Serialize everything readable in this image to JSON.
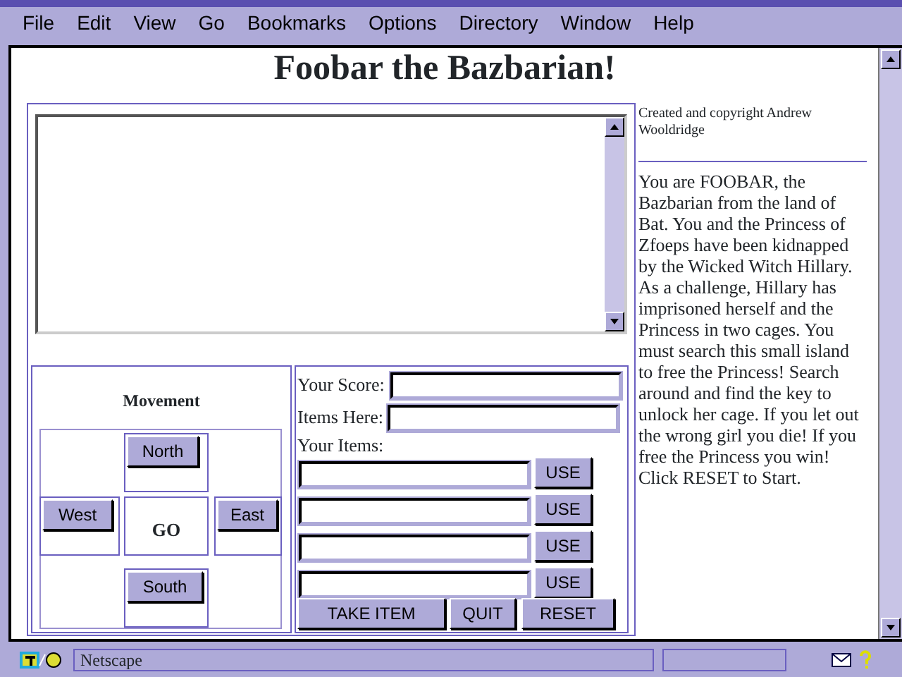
{
  "menu": [
    "File",
    "Edit",
    "View",
    "Go",
    "Bookmarks",
    "Options",
    "Directory",
    "Window",
    "Help"
  ],
  "heading": "Foobar the Bazbarian!",
  "movement": {
    "title": "Movement",
    "north": "North",
    "west": "West",
    "center": "GO",
    "east": "East",
    "south": "South"
  },
  "score": {
    "label": "Your Score:"
  },
  "items_here": {
    "label": "Items Here:"
  },
  "your_items": {
    "label": "Your Items:",
    "slots": [
      {
        "button": "USE"
      },
      {
        "button": "USE"
      },
      {
        "button": "USE"
      },
      {
        "button": "USE"
      }
    ]
  },
  "actions": [
    "TAKE ITEM",
    "QUIT",
    "RESET"
  ],
  "credit": "Created and copyright Andrew Wooldridge",
  "story": "You are FOOBAR, the Bazbarian from the land of Bat. You and the Princess of Zfoeps have been kidnapped by the Wicked Witch Hillary. As a challenge, Hillary has imprisoned herself and the Princess in two cages. You must search this small island to free the Princess! Search around and find the key to unlock her cage. If you let out the wrong girl you die! If you free the Princess you win! Click RESET to Start.",
  "status_bar": {
    "text": "Netscape"
  }
}
